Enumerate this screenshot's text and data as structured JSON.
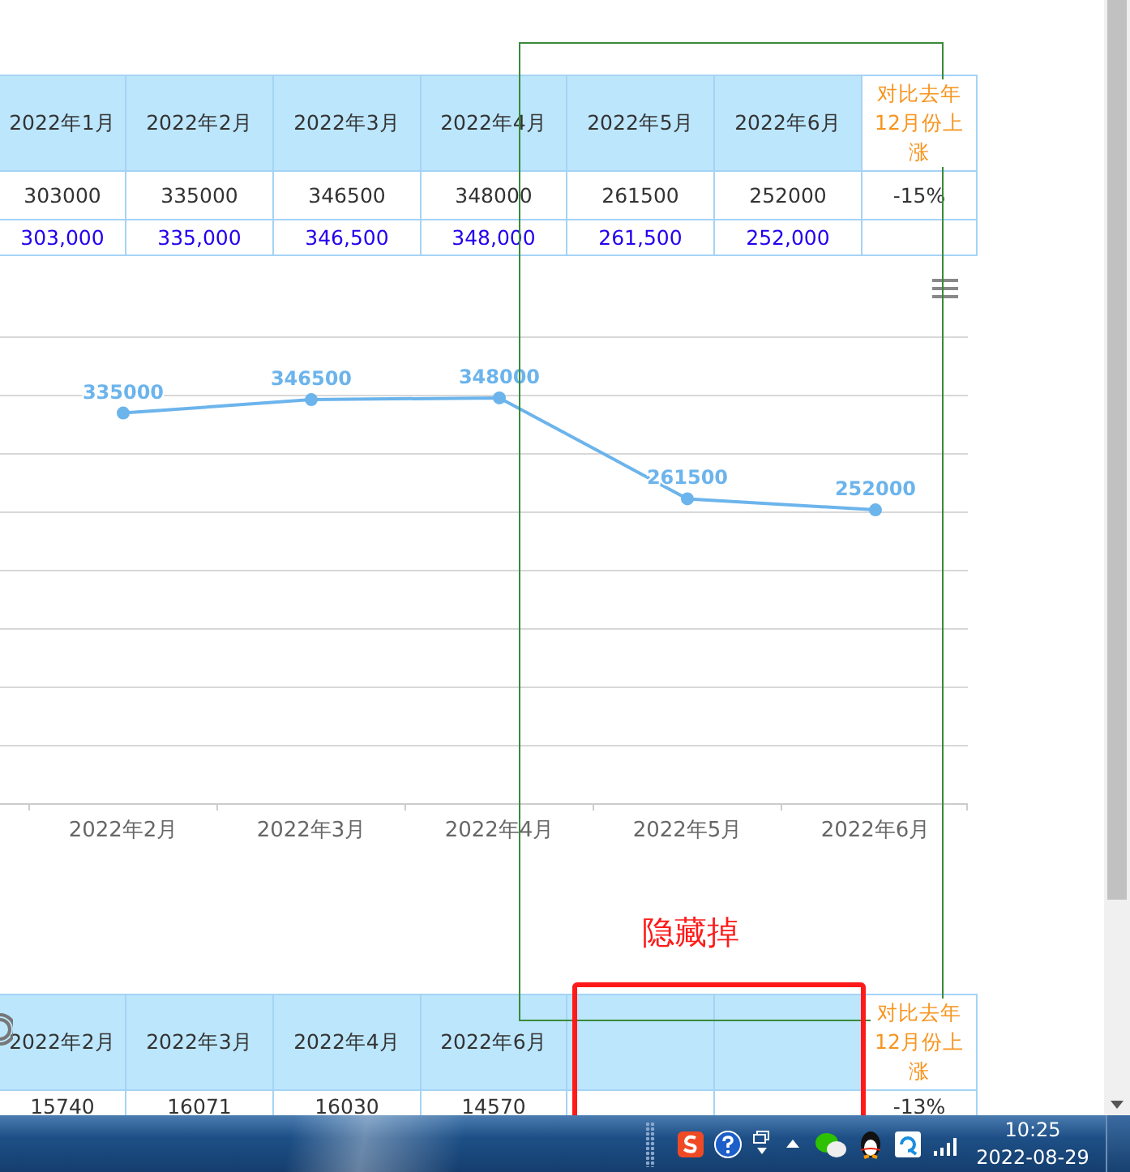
{
  "top_table": {
    "columns": [
      {
        "label": "2022年1月",
        "kind": "month"
      },
      {
        "label": "2022年2月",
        "kind": "month"
      },
      {
        "label": "2022年3月",
        "kind": "month"
      },
      {
        "label": "2022年4月",
        "kind": "month"
      },
      {
        "label": "2022年5月",
        "kind": "month"
      },
      {
        "label": "2022年6月",
        "kind": "month"
      },
      {
        "label": "对比去年12月份上涨",
        "kind": "comparison"
      }
    ],
    "rows": [
      {
        "kind": "plain",
        "cells": [
          "303000",
          "335000",
          "346500",
          "348000",
          "261500",
          "252000",
          "-15%"
        ]
      },
      {
        "kind": "formatted",
        "cells": [
          "303,000",
          "335,000",
          "346,500",
          "348,000",
          "261,500",
          "252,000",
          null
        ]
      }
    ]
  },
  "chart": {
    "chart_data": {
      "type": "line",
      "categories": [
        "2022年2月",
        "2022年3月",
        "2022年4月",
        "2022年5月",
        "2022年6月"
      ],
      "series": [
        {
          "color": "#6cb4ec",
          "marker": true,
          "values": [
            335000,
            346500,
            348000,
            261500,
            252000
          ]
        }
      ],
      "ylim": [
        0,
        400000
      ],
      "data_labels": true,
      "value_labels": [
        "335000",
        "346500",
        "348000",
        "261500",
        "252000"
      ]
    }
  },
  "markup": {
    "label": "隐藏掉",
    "frames": [
      {
        "color": "#3a8a3a"
      },
      {
        "color": "#ff1a1a"
      }
    ]
  },
  "bottom_table": {
    "columns": [
      {
        "label": "2022年2月",
        "kind": "month"
      },
      {
        "label": "2022年3月",
        "kind": "month"
      },
      {
        "label": "2022年4月",
        "kind": "month"
      },
      {
        "label": "2022年6月",
        "kind": "month"
      },
      {
        "kind": "month"
      },
      {
        "kind": "month"
      },
      {
        "label": "对比去年12月份上涨",
        "kind": "comparison"
      }
    ],
    "rows": [
      {
        "kind": "plain",
        "cells": [
          "15740",
          "16071",
          "16030",
          "14570",
          null,
          null,
          "-13%"
        ]
      }
    ]
  },
  "taskbar": {
    "time": "10:25",
    "date": "2022-08-29"
  }
}
